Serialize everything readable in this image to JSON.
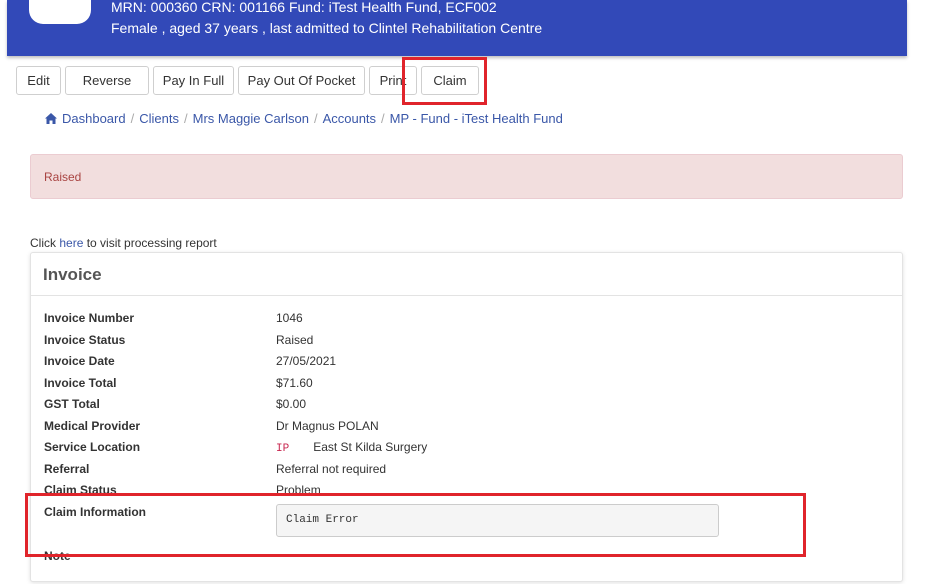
{
  "header": {
    "line1": "MRN: 000360   CRN: 001166   Fund: iTest Health Fund, ECF002",
    "line2": "Female , aged 37 years , last admitted to Clintel Rehabilitation Centre"
  },
  "toolbar": {
    "edit": "Edit",
    "reverse": "Reverse",
    "pay_in_full": "Pay In Full",
    "pay_out_of_pocket": "Pay Out Of Pocket",
    "print": "Print",
    "claim": "Claim"
  },
  "breadcrumb": {
    "dashboard": "Dashboard",
    "clients": "Clients",
    "client": "Mrs Maggie Carlson",
    "accounts": "Accounts",
    "current": "MP - Fund - iTest Health Fund",
    "separator": "/"
  },
  "alert": {
    "text": "Raised"
  },
  "report": {
    "prefix": "Click ",
    "link": "here",
    "suffix": " to visit processing report"
  },
  "invoice": {
    "title": "Invoice",
    "rows": [
      {
        "label": "Invoice Number",
        "value": "1046"
      },
      {
        "label": "Invoice Status",
        "value": "Raised"
      },
      {
        "label": "Invoice Date",
        "value": "27/05/2021"
      },
      {
        "label": "Invoice Total",
        "value": "$71.60"
      },
      {
        "label": "GST Total",
        "value": "$0.00"
      },
      {
        "label": "Medical Provider",
        "value": "Dr Magnus POLAN"
      },
      {
        "label": "Service Location",
        "tag": "IP",
        "value": "East St Kilda Surgery"
      },
      {
        "label": "Referral",
        "value": "Referral not required"
      },
      {
        "label": "Claim Status",
        "value": "Problem"
      },
      {
        "label": "Claim Information",
        "value": "Claim Error"
      },
      {
        "label": "Note",
        "value": ""
      }
    ]
  },
  "colors": {
    "header_bg": "#3249b8",
    "link": "#3a57a8",
    "alert_bg": "#f2dede",
    "alert_text": "#a94442",
    "highlight": "#e0242b"
  }
}
